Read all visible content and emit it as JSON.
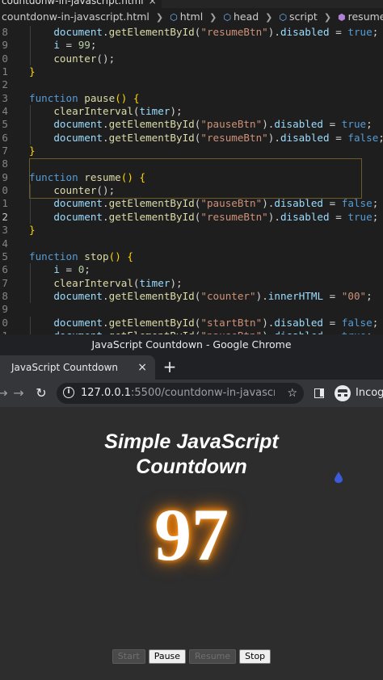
{
  "editor": {
    "active_tab": "countdonw-in-javascript.html",
    "tab_close": "×",
    "breadcrumb": [
      "countdonw-in-javascript.html",
      "html",
      "head",
      "script",
      "resume"
    ],
    "lines": [
      {
        "num": "8",
        "tokens": [
          [
            "p",
            "    "
          ],
          [
            "v",
            "document"
          ],
          [
            "p",
            "."
          ],
          [
            "f",
            "getElementById"
          ],
          [
            "p",
            "("
          ],
          [
            "s",
            "\"resumeBtn\""
          ],
          [
            "p",
            ")."
          ],
          [
            "v",
            "disabled"
          ],
          [
            "p",
            " = "
          ],
          [
            "k",
            "true"
          ],
          [
            "p",
            ";"
          ]
        ]
      },
      {
        "num": "9",
        "tokens": [
          [
            "p",
            "    "
          ],
          [
            "v",
            "i"
          ],
          [
            "p",
            " = "
          ],
          [
            "n",
            "99"
          ],
          [
            "p",
            ";"
          ]
        ]
      },
      {
        "num": "0",
        "tokens": [
          [
            "p",
            "    "
          ],
          [
            "f",
            "counter"
          ],
          [
            "p",
            "();"
          ]
        ]
      },
      {
        "num": "1",
        "tokens": [
          [
            "br",
            "}"
          ]
        ]
      },
      {
        "num": "2",
        "tokens": []
      },
      {
        "num": "3",
        "tokens": [
          [
            "k",
            "function"
          ],
          [
            "p",
            " "
          ],
          [
            "f",
            "pause"
          ],
          [
            "br",
            "()"
          ],
          [
            "p",
            " "
          ],
          [
            "br",
            "{"
          ]
        ]
      },
      {
        "num": "4",
        "tokens": [
          [
            "p",
            "    "
          ],
          [
            "f",
            "clearInterval"
          ],
          [
            "p",
            "("
          ],
          [
            "v",
            "timer"
          ],
          [
            "p",
            ");"
          ]
        ]
      },
      {
        "num": "5",
        "tokens": [
          [
            "p",
            "    "
          ],
          [
            "v",
            "document"
          ],
          [
            "p",
            "."
          ],
          [
            "f",
            "getElementById"
          ],
          [
            "p",
            "("
          ],
          [
            "s",
            "\"pauseBtn\""
          ],
          [
            "p",
            ")."
          ],
          [
            "v",
            "disabled"
          ],
          [
            "p",
            " = "
          ],
          [
            "k",
            "true"
          ],
          [
            "p",
            ";"
          ]
        ]
      },
      {
        "num": "6",
        "tokens": [
          [
            "p",
            "    "
          ],
          [
            "v",
            "document"
          ],
          [
            "p",
            "."
          ],
          [
            "f",
            "getElementById"
          ],
          [
            "p",
            "("
          ],
          [
            "s",
            "\"resumeBtn\""
          ],
          [
            "p",
            ")."
          ],
          [
            "v",
            "disabled"
          ],
          [
            "p",
            " = "
          ],
          [
            "k",
            "false"
          ],
          [
            "p",
            ";"
          ]
        ]
      },
      {
        "num": "7",
        "tokens": [
          [
            "br",
            "}"
          ]
        ]
      },
      {
        "num": "8",
        "tokens": []
      },
      {
        "num": "9",
        "tokens": [
          [
            "k",
            "function"
          ],
          [
            "p",
            " "
          ],
          [
            "f",
            "resume"
          ],
          [
            "br",
            "()"
          ],
          [
            "p",
            " "
          ],
          [
            "br",
            "{"
          ]
        ]
      },
      {
        "num": "0",
        "tokens": [
          [
            "p",
            "    "
          ],
          [
            "f",
            "counter"
          ],
          [
            "p",
            "();"
          ]
        ]
      },
      {
        "num": "1",
        "tokens": [
          [
            "p",
            "    "
          ],
          [
            "v",
            "document"
          ],
          [
            "p",
            "."
          ],
          [
            "f",
            "getElementById"
          ],
          [
            "p",
            "("
          ],
          [
            "s",
            "\"pauseBtn\""
          ],
          [
            "p",
            ")."
          ],
          [
            "v",
            "disabled"
          ],
          [
            "p",
            " = "
          ],
          [
            "k",
            "false"
          ],
          [
            "p",
            ";"
          ]
        ]
      },
      {
        "num": "2",
        "current": true,
        "tokens": [
          [
            "p",
            "    "
          ],
          [
            "v",
            "document"
          ],
          [
            "p",
            "."
          ],
          [
            "f",
            "getElementById"
          ],
          [
            "p",
            "("
          ],
          [
            "s",
            "\"resumeBtn\""
          ],
          [
            "p",
            ")."
          ],
          [
            "v",
            "disabled"
          ],
          [
            "p",
            " = "
          ],
          [
            "k",
            "true"
          ],
          [
            "p",
            ";"
          ]
        ]
      },
      {
        "num": "3",
        "tokens": [
          [
            "br",
            "}"
          ]
        ]
      },
      {
        "num": "4",
        "tokens": []
      },
      {
        "num": "5",
        "tokens": [
          [
            "k",
            "function"
          ],
          [
            "p",
            " "
          ],
          [
            "f",
            "stop"
          ],
          [
            "br",
            "()"
          ],
          [
            "p",
            " "
          ],
          [
            "br",
            "{"
          ]
        ]
      },
      {
        "num": "6",
        "tokens": [
          [
            "p",
            "    "
          ],
          [
            "v",
            "i"
          ],
          [
            "p",
            " = "
          ],
          [
            "n",
            "0"
          ],
          [
            "p",
            ";"
          ]
        ]
      },
      {
        "num": "7",
        "tokens": [
          [
            "p",
            "    "
          ],
          [
            "f",
            "clearInterval"
          ],
          [
            "p",
            "("
          ],
          [
            "v",
            "timer"
          ],
          [
            "p",
            ");"
          ]
        ]
      },
      {
        "num": "8",
        "tokens": [
          [
            "p",
            "    "
          ],
          [
            "v",
            "document"
          ],
          [
            "p",
            "."
          ],
          [
            "f",
            "getElementById"
          ],
          [
            "p",
            "("
          ],
          [
            "s",
            "\"counter\""
          ],
          [
            "p",
            ")."
          ],
          [
            "v",
            "innerHTML"
          ],
          [
            "p",
            " = "
          ],
          [
            "s",
            "\"00\""
          ],
          [
            "p",
            ";"
          ]
        ]
      },
      {
        "num": "9",
        "tokens": []
      },
      {
        "num": "0",
        "tokens": [
          [
            "p",
            "    "
          ],
          [
            "v",
            "document"
          ],
          [
            "p",
            "."
          ],
          [
            "f",
            "getElementById"
          ],
          [
            "p",
            "("
          ],
          [
            "s",
            "\"startBtn\""
          ],
          [
            "p",
            ")."
          ],
          [
            "v",
            "disabled"
          ],
          [
            "p",
            " = "
          ],
          [
            "k",
            "false"
          ],
          [
            "p",
            ";"
          ]
        ]
      },
      {
        "num": "1",
        "tokens": [
          [
            "p",
            "    "
          ],
          [
            "v",
            "document"
          ],
          [
            "p",
            "."
          ],
          [
            "f",
            "getElementById"
          ],
          [
            "p",
            "("
          ],
          [
            "s",
            "\"pauseBtn\""
          ],
          [
            "p",
            ")."
          ],
          [
            "v",
            "disabled"
          ],
          [
            "p",
            " = "
          ],
          [
            "k",
            "true"
          ],
          [
            "p",
            ";"
          ]
        ]
      }
    ]
  },
  "chrome": {
    "window_title": "JavaScript Countdown - Google Chrome",
    "tab_title": "JavaScript Countdown",
    "tab_close": "×",
    "new_tab": "+",
    "url_host": "127.0.0.1",
    "url_rest": ":5500/countdonw-in-javascri...",
    "profile_label": "Incog",
    "icons": [
      "back-arrow-icon",
      "forward-arrow-icon",
      "reload-icon",
      "info-icon",
      "star-icon",
      "side-panel-icon",
      "incognito-icon"
    ]
  },
  "page": {
    "title_line1": "Simple JavaScript",
    "title_line2": "Countdown",
    "counter": "97",
    "buttons": {
      "start": "Start",
      "pause": "Pause",
      "resume": "Resume",
      "stop": "Stop"
    }
  },
  "colors": {
    "editor_bg": "#1e1e1e",
    "keyword": "#569cd6",
    "function": "#dcdcaa",
    "variable": "#9cdcfe",
    "string": "#ce9178",
    "number": "#b5cea8",
    "counter_glow": "#ff8a00",
    "page_bg": "#2d2d2d"
  }
}
